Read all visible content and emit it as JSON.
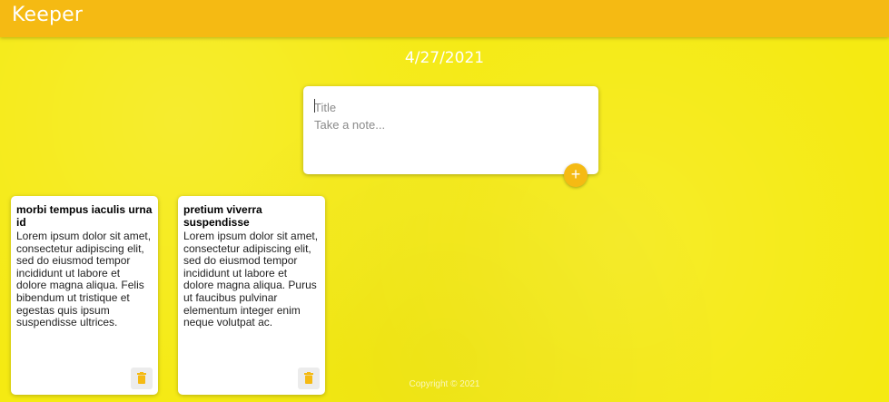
{
  "header": {
    "brand": "Keeper"
  },
  "date": "4/27/2021",
  "create_note": {
    "title_placeholder": "Title",
    "content_placeholder": "Take a note...",
    "add_icon": "+"
  },
  "notes": [
    {
      "title": "morbi tempus iaculis urna id",
      "content": "Lorem ipsum dolor sit amet, consectetur adipiscing elit, sed do eiusmod tempor incididunt ut labore et dolore magna aliqua. Felis bibendum ut tristique et egestas quis ipsum suspendisse ultrices."
    },
    {
      "title": "pretium viverra suspendisse",
      "content": "Lorem ipsum dolor sit amet, consectetur adipiscing elit, sed do eiusmod tempor incididunt ut labore et dolore magna aliqua. Purus ut faucibus pulvinar elementum integer enim neque volutpat ac."
    }
  ],
  "footer": {
    "copyright": "Copyright © 2021"
  },
  "colors": {
    "accent": "#f5ba13",
    "background": "#f5ea12"
  },
  "icons": {
    "add": "plus-icon",
    "delete": "trash-icon"
  }
}
